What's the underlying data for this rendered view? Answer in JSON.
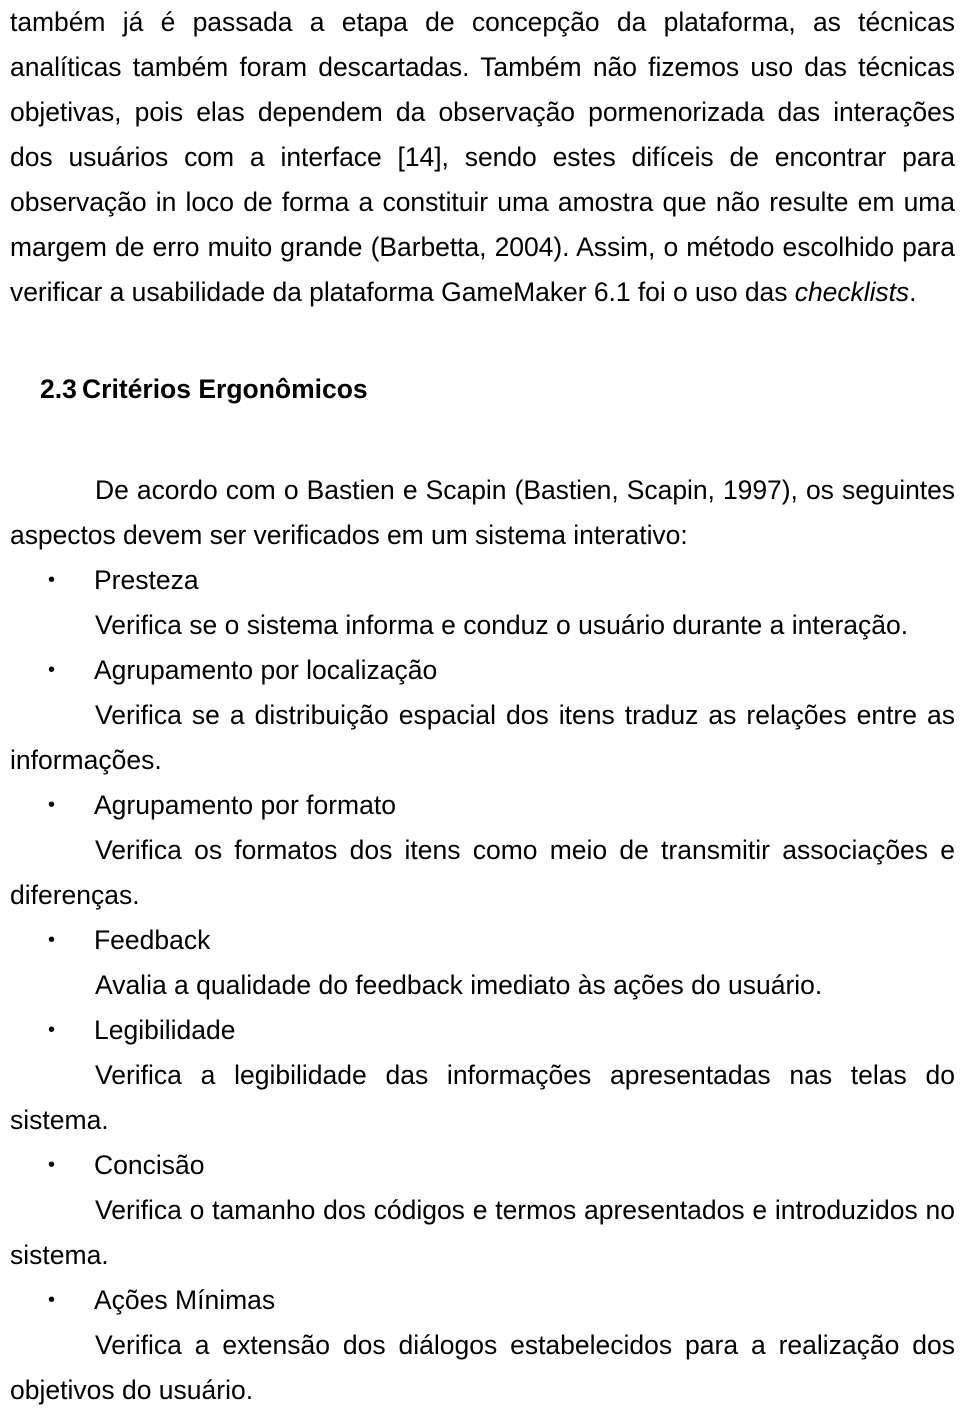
{
  "document": {
    "intro_paragraph": {
      "lead": "também já é passada a etapa de concepção da plataforma, as técnicas analíticas também foram descartadas. Também não fizemos uso das técnicas objetivas, pois elas dependem da observação pormenorizada das interações dos usuários com a interface [14], sendo estes difíceis de encontrar para observação in loco de forma a constituir uma amostra que não resulte em uma margem de erro muito grande (Barbetta, 2004). Assim, o método escolhido para verificar a usabilidade da plataforma GameMaker 6.1 foi o uso das ",
      "italic_tail": "checklists",
      "tail_end": "."
    },
    "section": {
      "number": "2.3",
      "title": "Critérios Ergonômicos"
    },
    "lead_paragraph": "De acordo com o Bastien e Scapin (Bastien, Scapin, 1997), os seguintes aspectos devem ser verificados em um sistema interativo:",
    "bullet_glyph": "•",
    "criteria": [
      {
        "term": "Presteza",
        "description": "Verifica se o sistema informa e conduz o usuário durante a interação."
      },
      {
        "term": "Agrupamento por localização",
        "description": "Verifica se a distribuição espacial dos itens traduz as relações entre as informações."
      },
      {
        "term": "Agrupamento por formato",
        "description": "Verifica os formatos dos itens como meio de transmitir associações e diferenças."
      },
      {
        "term": "Feedback",
        "description": "Avalia a qualidade do feedback imediato às ações do usuário."
      },
      {
        "term": "Legibilidade",
        "description": "Verifica a legibilidade das informações apresentadas nas telas do sistema."
      },
      {
        "term": "Concisão",
        "description": "Verifica o tamanho dos códigos e termos apresentados e introduzidos no sistema."
      },
      {
        "term": "Ações Mínimas",
        "description": "Verifica a extensão dos diálogos estabelecidos para a realização dos objetivos do usuário."
      }
    ]
  }
}
